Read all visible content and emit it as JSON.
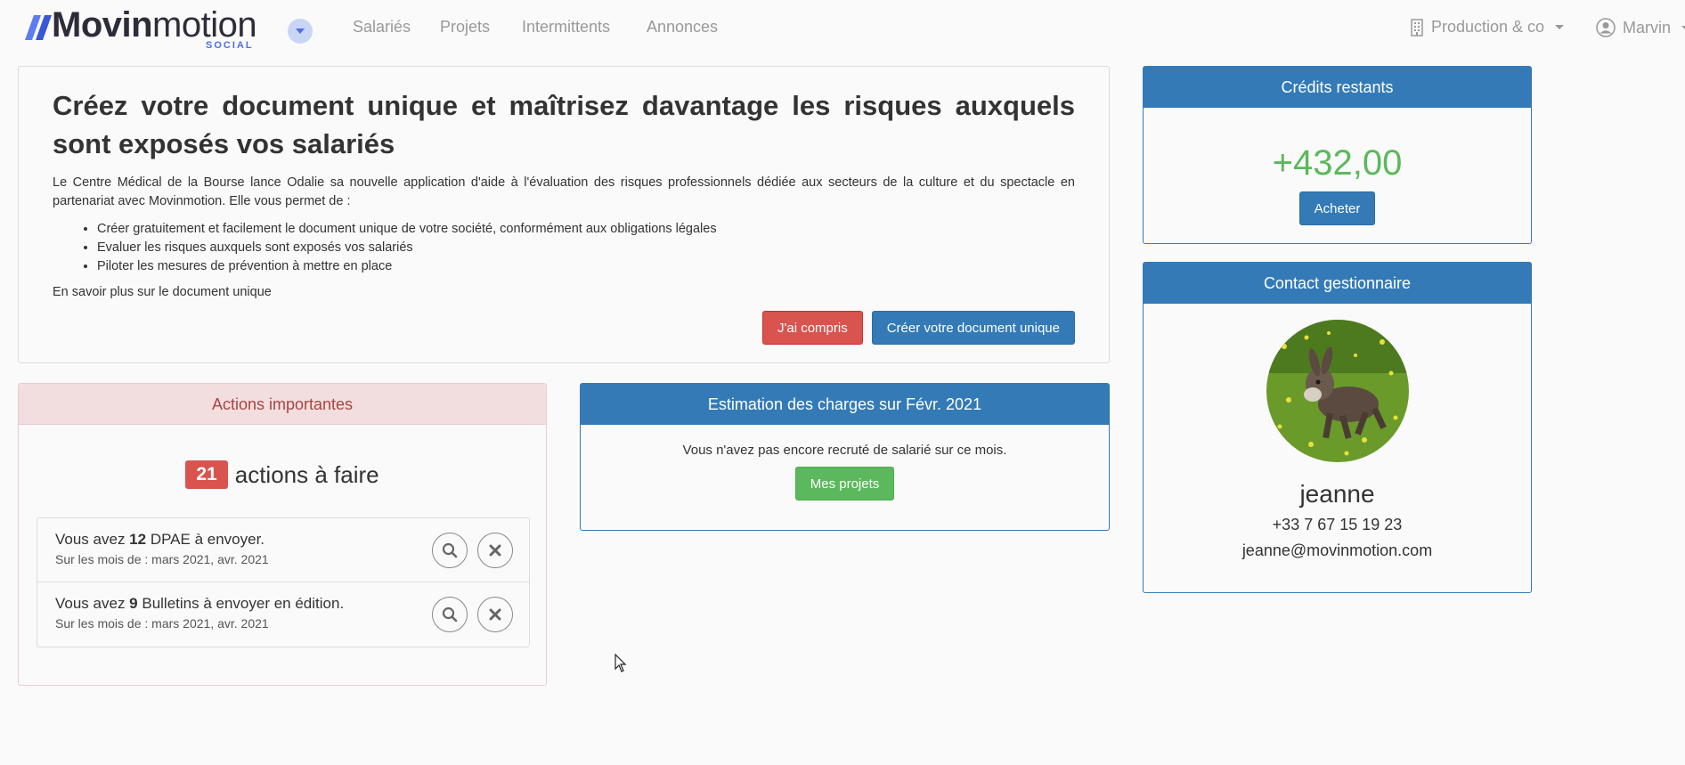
{
  "brand": {
    "name_bold": "Movin",
    "name_light": "motion",
    "sub": "SOCIAL",
    "accent": "#4e6ee8"
  },
  "nav": {
    "toggle_icon": "chevron-down-icon",
    "links": [
      "Salariés",
      "Projets",
      "Intermittents",
      "Annonces"
    ],
    "company": "Production & co",
    "user": "Marvin"
  },
  "promo": {
    "title": "Créez votre document unique et maîtrisez davantage les risques auxquels sont exposés vos salariés",
    "text": "Le Centre Médical de la Bourse lance Odalie sa nouvelle application d'aide à l'évaluation des risques professionnels dédiée aux secteurs de la culture et du spectacle en partenariat avec Movinmotion. Elle vous permet de :",
    "bullets": [
      "Créer gratuitement et facilement le document unique de votre société, conformément aux obligations légales",
      "Evaluer les risques auxquels sont exposés vos salariés",
      "Piloter les mesures de prévention à mettre en place"
    ],
    "more_link": "En savoir plus sur le document unique",
    "btn_ok": "J'ai compris",
    "btn_create": "Créer votre document unique"
  },
  "actions": {
    "heading": "Actions importantes",
    "count": "21",
    "count_label": "actions à faire",
    "items": [
      {
        "prefix": "Vous avez ",
        "count": "12",
        "suffix": " DPAE à envoyer.",
        "sub": "Sur les mois de : mars 2021, avr. 2021"
      },
      {
        "prefix": "Vous avez ",
        "count": "9",
        "suffix": " Bulletins à envoyer en édition.",
        "sub": "Sur les mois de : mars 2021, avr. 2021"
      }
    ]
  },
  "charges": {
    "heading": "Estimation des charges sur Févr. 2021",
    "text": "Vous n'avez pas encore recruté de salarié sur ce mois.",
    "btn": "Mes projets"
  },
  "credits": {
    "heading": "Crédits restants",
    "value": "+432,00",
    "btn": "Acheter"
  },
  "contact": {
    "heading": "Contact gestionnaire",
    "name": "jeanne",
    "phone": "+33 7 67 15 19 23",
    "email": "jeanne@movinmotion.com"
  },
  "colors": {
    "primary": "#337ab7",
    "danger": "#d9534f",
    "success": "#5cb85c",
    "danger_bg": "#f2dede"
  }
}
